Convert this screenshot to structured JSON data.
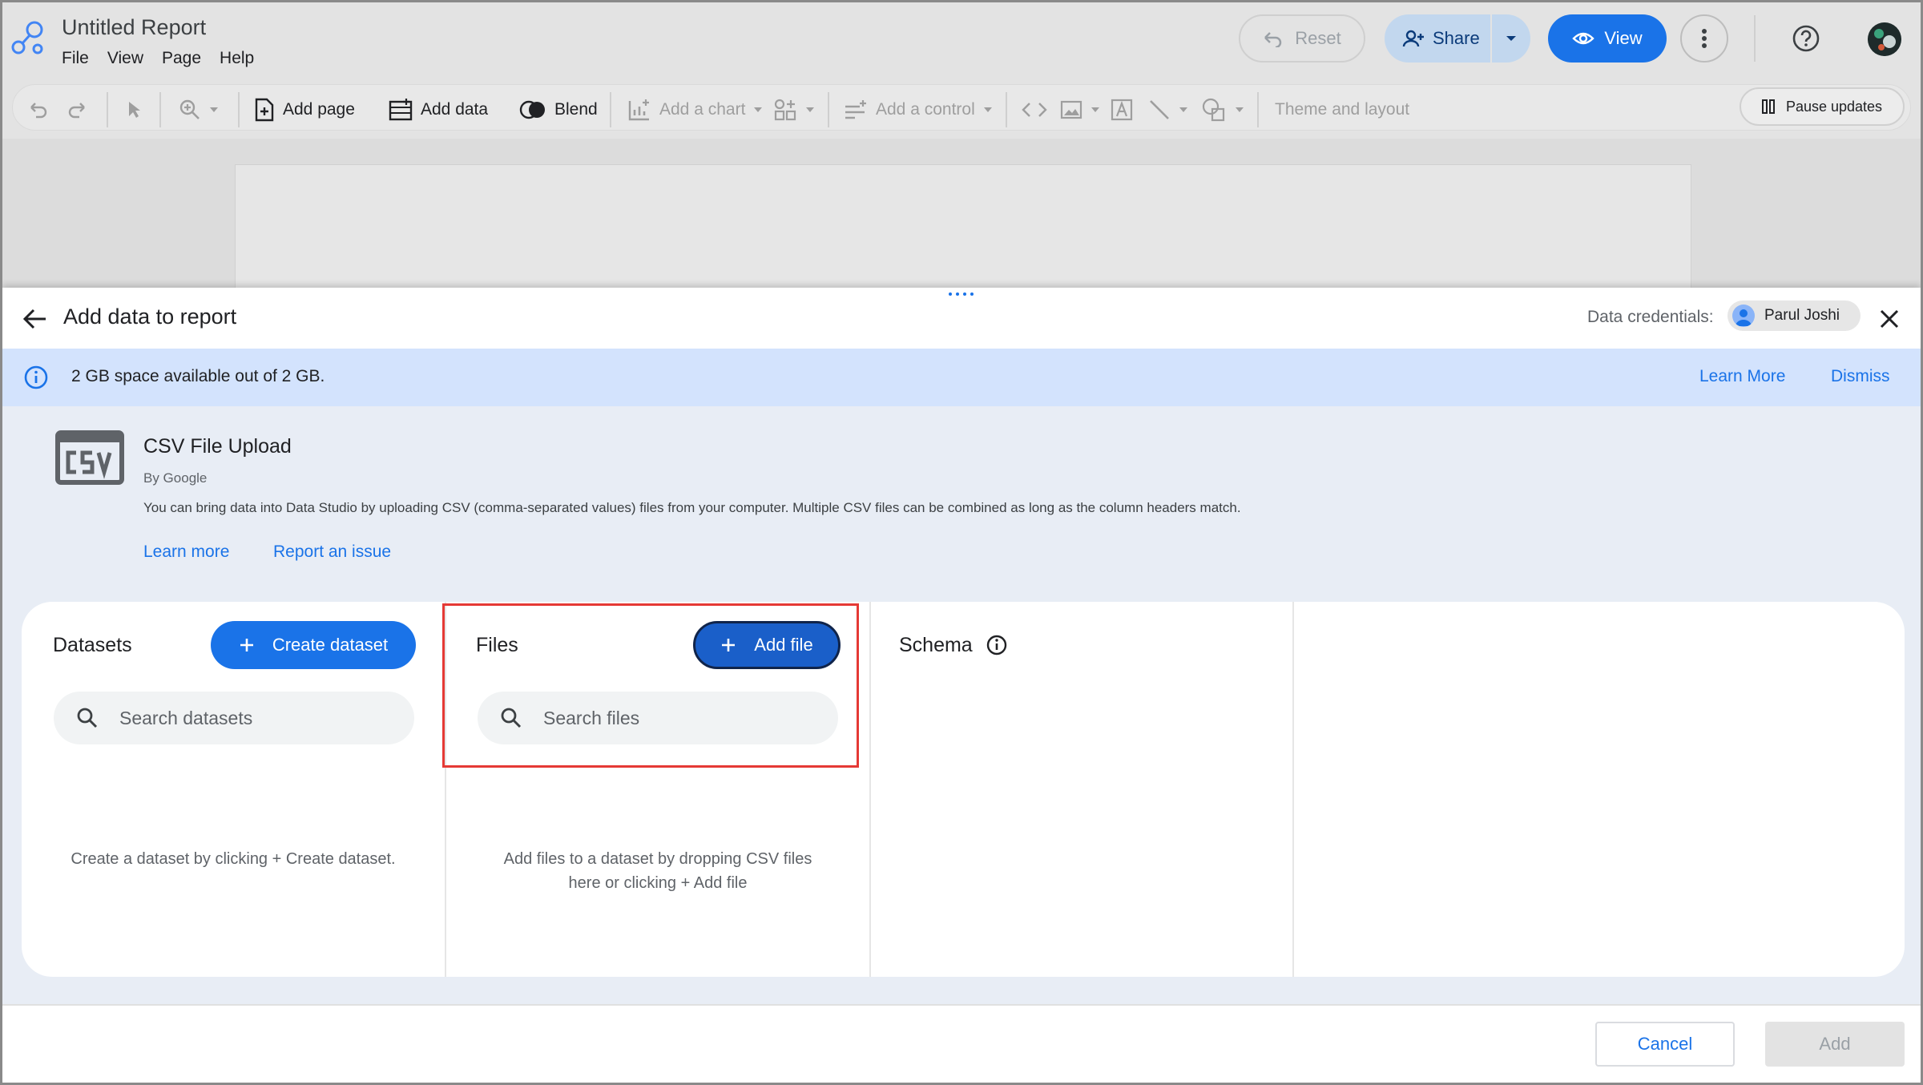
{
  "header": {
    "title": "Untitled Report",
    "menu": [
      "File",
      "View",
      "Page",
      "Help"
    ],
    "reset_label": "Reset",
    "share_label": "Share",
    "view_label": "View"
  },
  "toolbar": {
    "add_page": "Add page",
    "add_data": "Add data",
    "blend": "Blend",
    "add_chart": "Add a chart",
    "add_control": "Add a control",
    "theme_layout": "Theme and layout",
    "pause_updates": "Pause updates"
  },
  "panel": {
    "title": "Add data to report",
    "credentials_label": "Data credentials:",
    "credentials_user": "Parul Joshi",
    "banner": {
      "message": "2 GB space available out of 2 GB.",
      "learn_more": "Learn More",
      "dismiss": "Dismiss"
    },
    "connector": {
      "name": "CSV File Upload",
      "by": "By Google",
      "description": "You can bring data into Data Studio by uploading CSV (comma-separated values) files from your computer. Multiple CSV files can be combined as long as the column headers match.",
      "learn_more": "Learn more",
      "report_issue": "Report an issue"
    },
    "datasets": {
      "title": "Datasets",
      "create_label": "Create dataset",
      "search_placeholder": "Search datasets",
      "empty_text": "Create a dataset by clicking + Create dataset."
    },
    "files": {
      "title": "Files",
      "add_label": "Add file",
      "search_placeholder": "Search files",
      "empty_line1": "Add files to a dataset by dropping CSV files",
      "empty_line2": "here or clicking + Add file"
    },
    "schema": {
      "title": "Schema"
    },
    "footer": {
      "cancel": "Cancel",
      "add": "Add"
    }
  },
  "colors": {
    "primary": "#1a73e8",
    "banner_bg": "#d3e3fd",
    "highlight": "#e53935"
  }
}
